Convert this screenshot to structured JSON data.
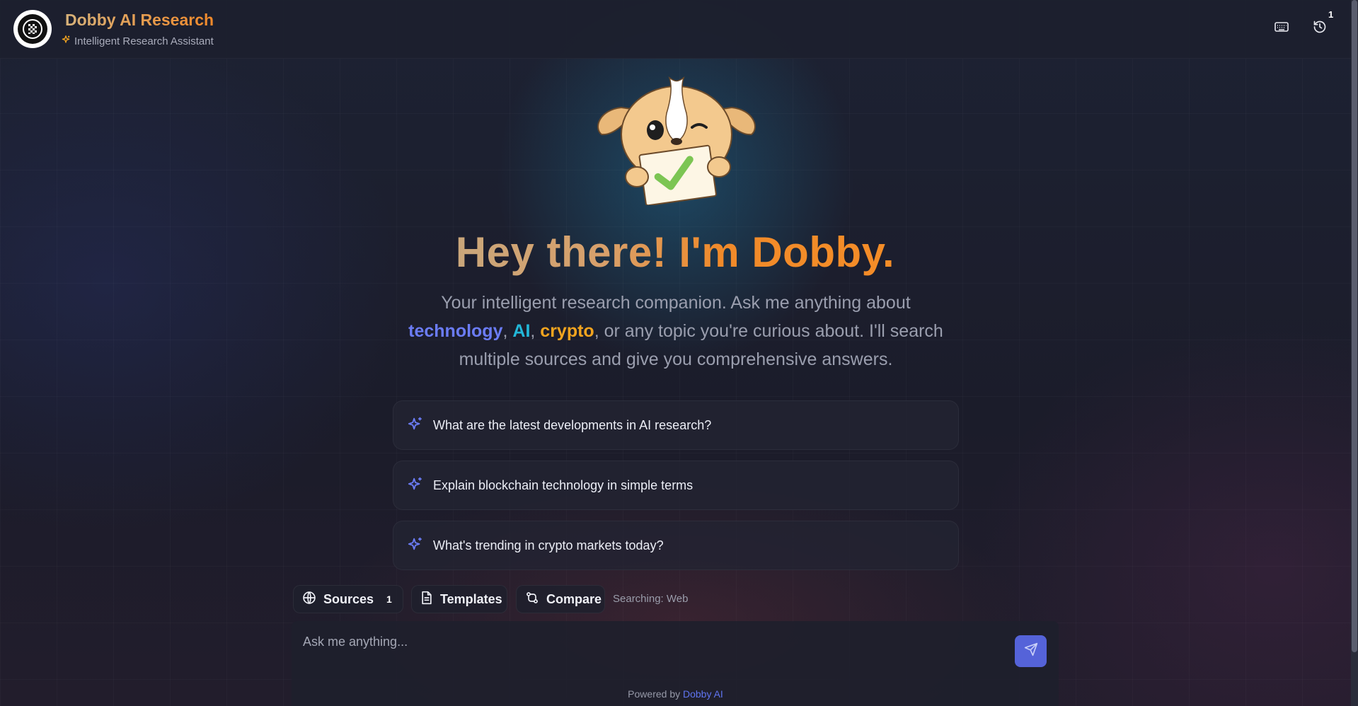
{
  "header": {
    "title": "Dobby AI Research",
    "subtitle": "Intelligent Research Assistant",
    "notification_count": "1",
    "icons": [
      "logo-icon",
      "sparkle-icon",
      "keyboard-icon",
      "history-icon"
    ]
  },
  "hero": {
    "title": "Hey there! I'm Dobby.",
    "desc_part1": "Your intelligent research companion. Ask me anything about ",
    "kw_technology": "technology",
    "sep1": ", ",
    "kw_ai": "AI",
    "sep2": ", ",
    "kw_crypto": "crypto",
    "desc_part2": ", or any topic you're curious about. I'll search multiple sources and give you comprehensive answers."
  },
  "suggestions": [
    {
      "label": "What are the latest developments in AI research?"
    },
    {
      "label": "Explain blockchain technology in simple terms"
    },
    {
      "label": "What's trending in crypto markets today?"
    }
  ],
  "toolbar": {
    "sources_label": "Sources",
    "sources_count": "1",
    "templates_label": "Templates",
    "compare_label": "Compare",
    "search_status": "Searching: Web"
  },
  "input": {
    "placeholder": "Ask me anything..."
  },
  "footer": {
    "prefix": "Powered by ",
    "brand": "Dobby AI"
  },
  "colors": {
    "accent_orange": "#f2892a",
    "accent_blue": "#5563d9",
    "keyword_technology": "#6b7cf5",
    "keyword_ai": "#22b7d8",
    "keyword_crypto": "#f2a41f"
  }
}
